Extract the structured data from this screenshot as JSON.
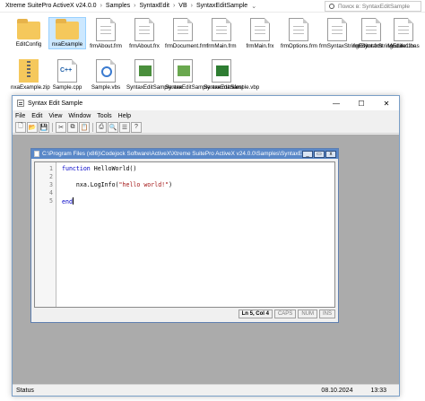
{
  "explorer": {
    "breadcrumb": [
      "Xtreme SuitePro ActiveX v24.0.0",
      "Samples",
      "SyntaxEdit",
      "VB",
      "SyntaxEditSample"
    ],
    "search_placeholder": "Поиск в: SyntaxEditSample",
    "files": [
      {
        "name": "EditConfig",
        "icon": "folder-icon"
      },
      {
        "name": "nxaExample",
        "icon": "folder-icon",
        "selected": true
      },
      {
        "name": "frmAbout.frm",
        "icon": "text-file-icon"
      },
      {
        "name": "frmAbout.frx",
        "icon": "text-file-icon"
      },
      {
        "name": "frmDocument.frm",
        "icon": "text-file-icon"
      },
      {
        "name": "frmMain.frm",
        "icon": "text-file-icon"
      },
      {
        "name": "frmMain.frx",
        "icon": "text-file-icon"
      },
      {
        "name": "frmOptions.frm",
        "icon": "text-file-icon"
      },
      {
        "name": "frmSyntaxStringEditor.frm",
        "icon": "text-file-icon"
      },
      {
        "name": "frmSyntaxStringEditor.frx",
        "icon": "text-file-icon"
      },
      {
        "name": "Module1.bas",
        "icon": "text-file-icon"
      },
      {
        "name": "nxaExample.zip",
        "icon": "zip-archive-icon"
      },
      {
        "name": "Sample.cpp",
        "icon": "cpp-file-icon"
      },
      {
        "name": "Sample.vbs",
        "icon": "vbscript-file-icon"
      },
      {
        "name": "SyntaxEditSample.exe",
        "icon": "exe-file-icon"
      },
      {
        "name": "SyntaxEditSample.exe.manifest",
        "icon": "manifest-file-icon"
      },
      {
        "name": "SyntaxEditSample.vbp",
        "icon": "vb-project-icon"
      }
    ]
  },
  "app": {
    "title": "Syntax Edit Sample",
    "window_buttons": {
      "minimize": "—",
      "maximize": "☐",
      "close": "✕"
    },
    "menu": [
      "File",
      "Edit",
      "View",
      "Window",
      "Tools",
      "Help"
    ],
    "toolbar": [
      "new-icon",
      "open-icon",
      "save-icon",
      "cut-icon",
      "copy-icon",
      "paste-icon",
      "print-icon",
      "find-icon",
      "properties-icon",
      "about-icon"
    ],
    "toolbar_glyphs": {
      "new-icon": "🗋",
      "open-icon": "📂",
      "save-icon": "💾",
      "cut-icon": "✂",
      "copy-icon": "⧉",
      "paste-icon": "📋",
      "print-icon": "⎙",
      "find-icon": "🔍",
      "properties-icon": "☰",
      "about-icon": "?"
    },
    "child": {
      "title": "C:\\Program Files (x86)\\Codejock Software\\ActiveX\\Xtreme SuitePro ActiveX v24.0.0\\Samples\\SyntaxEdit\\VB\\SyntaxEdi...",
      "buttons": {
        "minimize": "_",
        "restore": "▭",
        "close": "x"
      },
      "lines": [
        {
          "n": "1",
          "kw": "function",
          "rest": " HelloWorld()"
        },
        {
          "n": "2",
          "kw": "",
          "rest": ""
        },
        {
          "n": "3",
          "kw": "",
          "rest": "    nxa.LogInfo(",
          "str": "\"hello world!\"",
          "tail": ")"
        },
        {
          "n": "4",
          "kw": "",
          "rest": ""
        },
        {
          "n": "5",
          "kw": "end",
          "rest": ""
        }
      ],
      "status": {
        "position": "Ln 5, Col 4",
        "caps": "CAPS",
        "num": "NUM",
        "ins": "INS"
      }
    },
    "status": {
      "text": "Status",
      "date": "08.10.2024",
      "time": "13:33"
    }
  },
  "colors": {
    "accent": "#5a88c8",
    "keyword": "#0000c8",
    "string": "#a31515",
    "mdi_background": "#ababab"
  }
}
